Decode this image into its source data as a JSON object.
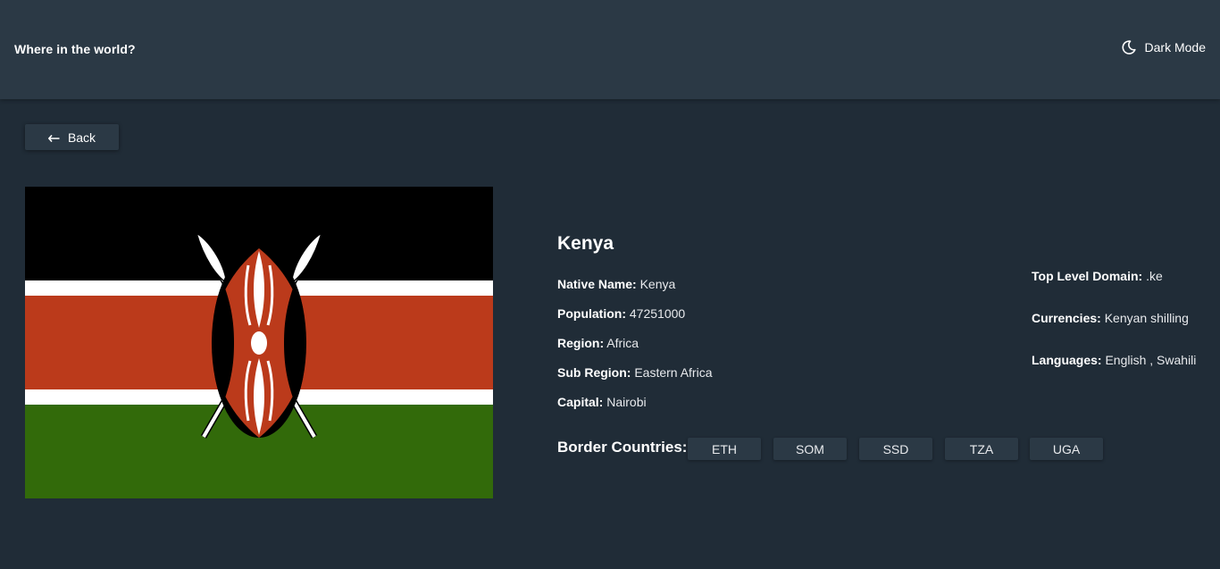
{
  "header": {
    "title": "Where in the world?",
    "theme_toggle_label": "Dark Mode",
    "theme_icon": "moon-icon"
  },
  "back": {
    "label": "Back",
    "icon": "arrow-left-icon"
  },
  "country": {
    "name": "Kenya",
    "flag": {
      "description_icon": "kenya-flag",
      "colors": {
        "black": "#000000",
        "white": "#ffffff",
        "red": "#bb3a1b",
        "green": "#326a0a"
      }
    },
    "fields_left": [
      {
        "key": "Native Name:",
        "value": "Kenya"
      },
      {
        "key": "Population:",
        "value": "47251000"
      },
      {
        "key": "Region:",
        "value": "Africa"
      },
      {
        "key": "Sub Region:",
        "value": "Eastern Africa"
      },
      {
        "key": "Capital:",
        "value": "Nairobi"
      }
    ],
    "fields_right": [
      {
        "key": "Top Level Domain:",
        "value": ".ke"
      },
      {
        "key": "Currencies:",
        "value": "Kenyan shilling"
      },
      {
        "key": "Languages:",
        "value": "English , Swahili"
      }
    ],
    "border_label": "Border Countries:",
    "borders": [
      "ETH",
      "SOM",
      "SSD",
      "TZA",
      "UGA"
    ]
  },
  "theme": {
    "background": "#202c37",
    "elements": "#2b3945",
    "text": "#ffffff"
  }
}
